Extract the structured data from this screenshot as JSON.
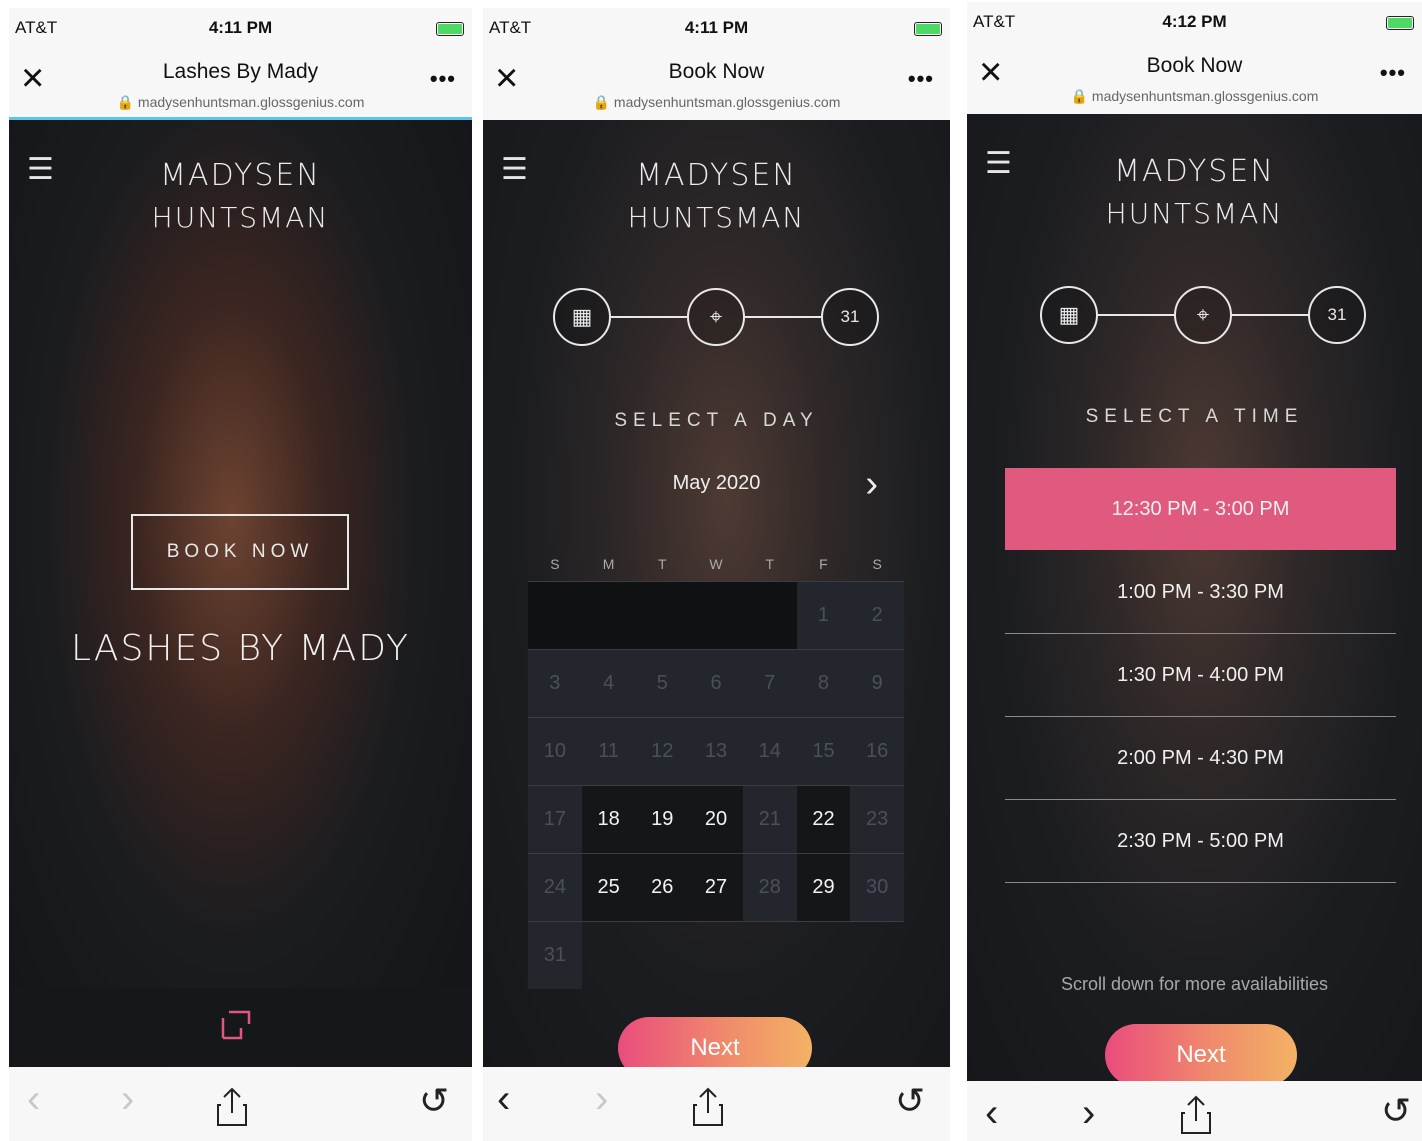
{
  "phone1": {
    "status": {
      "carrier": "AT&T",
      "time": "4:11 PM"
    },
    "url": {
      "title": "Lashes By Mady",
      "domain": "madysenhuntsman.glossgenius.com"
    },
    "brand": {
      "line1": "MADYSEN",
      "line2": "HUNTSMAN"
    },
    "book_now": "BOOK NOW",
    "hero_name": "LASHES BY MADY"
  },
  "phone2": {
    "status": {
      "carrier": "AT&T",
      "time": "4:11 PM"
    },
    "url": {
      "title": "Book Now",
      "domain": "madysenhuntsman.glossgenius.com"
    },
    "brand": {
      "line1": "MADYSEN",
      "line2": "HUNTSMAN"
    },
    "step3_icon_text": "31",
    "section": "SELECT A DAY",
    "month": "May 2020",
    "weekdays": [
      "S",
      "M",
      "T",
      "W",
      "T",
      "F",
      "S"
    ],
    "rows": [
      [
        {
          "d": "",
          "s": "emptydark"
        },
        {
          "d": "",
          "s": "emptydark"
        },
        {
          "d": "",
          "s": "emptydark"
        },
        {
          "d": "",
          "s": "emptydark"
        },
        {
          "d": "",
          "s": "emptydark"
        },
        {
          "d": "1",
          "s": "off"
        },
        {
          "d": "2",
          "s": "off"
        }
      ],
      [
        {
          "d": "3",
          "s": "off"
        },
        {
          "d": "4",
          "s": "off"
        },
        {
          "d": "5",
          "s": "off"
        },
        {
          "d": "6",
          "s": "off"
        },
        {
          "d": "7",
          "s": "off"
        },
        {
          "d": "8",
          "s": "off"
        },
        {
          "d": "9",
          "s": "off"
        }
      ],
      [
        {
          "d": "10",
          "s": "off"
        },
        {
          "d": "11",
          "s": "off"
        },
        {
          "d": "12",
          "s": "off"
        },
        {
          "d": "13",
          "s": "off"
        },
        {
          "d": "14",
          "s": "off"
        },
        {
          "d": "15",
          "s": "off"
        },
        {
          "d": "16",
          "s": "off"
        }
      ],
      [
        {
          "d": "17",
          "s": "off"
        },
        {
          "d": "18",
          "s": "avail"
        },
        {
          "d": "19",
          "s": "avail"
        },
        {
          "d": "20",
          "s": "avail"
        },
        {
          "d": "21",
          "s": "off"
        },
        {
          "d": "22",
          "s": "avail"
        },
        {
          "d": "23",
          "s": "off"
        }
      ],
      [
        {
          "d": "24",
          "s": "off"
        },
        {
          "d": "25",
          "s": "avail"
        },
        {
          "d": "26",
          "s": "avail"
        },
        {
          "d": "27",
          "s": "avail"
        },
        {
          "d": "28",
          "s": "off"
        },
        {
          "d": "29",
          "s": "avail"
        },
        {
          "d": "30",
          "s": "off"
        }
      ],
      [
        {
          "d": "31",
          "s": "off"
        },
        {
          "d": "",
          "s": "empty"
        },
        {
          "d": "",
          "s": "empty"
        },
        {
          "d": "",
          "s": "empty"
        },
        {
          "d": "",
          "s": "empty"
        },
        {
          "d": "",
          "s": "empty"
        },
        {
          "d": "",
          "s": "empty"
        }
      ]
    ],
    "next": "Next"
  },
  "phone3": {
    "status": {
      "carrier": "AT&T",
      "time": "4:12 PM"
    },
    "url": {
      "title": "Book Now",
      "domain": "madysenhuntsman.glossgenius.com"
    },
    "brand": {
      "line1": "MADYSEN",
      "line2": "HUNTSMAN"
    },
    "step3_icon_text": "31",
    "section": "SELECT A TIME",
    "slots": [
      "12:30 PM - 3:00 PM",
      "1:00 PM - 3:30 PM",
      "1:30 PM - 4:00 PM",
      "2:00 PM - 4:30 PM",
      "2:30 PM - 5:00 PM"
    ],
    "selected_slot": 0,
    "scroll_hint": "Scroll down for more availabilities",
    "next": "Next"
  },
  "colors": {
    "accent_pink": "#e05a80",
    "gradient_start": "#ea4c7d",
    "gradient_end": "#f3b264",
    "progress_blue": "#58c6ee"
  }
}
